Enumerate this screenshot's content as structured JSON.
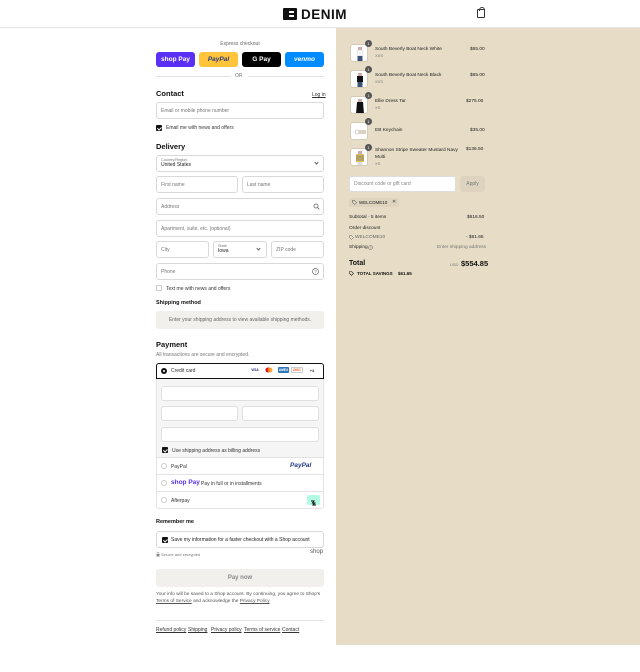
{
  "header": {
    "brand": "DENIM"
  },
  "express": {
    "label": "Express checkout",
    "shop_pay": "shop Pay",
    "paypal": "PayPal",
    "gpay": "G Pay",
    "venmo": "venmo",
    "or": "OR"
  },
  "contact": {
    "title": "Contact",
    "login": "Log in",
    "email_placeholder": "Email or mobile phone number",
    "news_label": "Email me with news and offers"
  },
  "delivery": {
    "title": "Delivery",
    "country_label": "Country/Region",
    "country_value": "United States",
    "first_name": "First name",
    "last_name": "Last name",
    "address": "Address",
    "apartment": "Apartment, suite, etc. (optional)",
    "city": "City",
    "state_label": "State",
    "state_value": "Iowa",
    "zip": "ZIP code",
    "phone": "Phone",
    "text_offers": "Text me with news and offers"
  },
  "shipping": {
    "title": "Shipping method",
    "placeholder": "Enter your shipping address to view available shipping methods."
  },
  "payment": {
    "title": "Payment",
    "subtitle": "All transactions are secure and encrypted.",
    "credit_card": "Credit card",
    "brands": [
      "VISA",
      "MC",
      "AMEX",
      "DISC",
      "+4"
    ],
    "billing_same": "Use shipping address as billing address",
    "paypal": "PayPal",
    "paypal_logo": "PayPal",
    "shop_pay_logo": "shop Pay",
    "shop_pay_text": "Pay in full or in installments",
    "afterpay": "Afterpay"
  },
  "remember": {
    "title": "Remember me",
    "save_label": "Save my information for a faster checkout with a Shop account",
    "secure": "Secure and encrypted",
    "shop": "shop"
  },
  "pay_now": "Pay now",
  "legal": {
    "line1": "Your info will be saved to a Shop account. By continuing, you agree to Shop's",
    "terms": "Terms of Service",
    "mid": "and acknowledge the",
    "privacy": "Privacy Policy"
  },
  "footer_links": [
    "Refund policy",
    "Shipping",
    "Privacy policy",
    "Terms of service",
    "Contact"
  ],
  "cart": {
    "items": [
      {
        "name": "South Beverly Boat Neck White",
        "variant": "XXS",
        "price": "$65.00",
        "qty": "1"
      },
      {
        "name": "South Beverly Boat Neck Black",
        "variant": "XXS",
        "price": "$65.00",
        "qty": "1"
      },
      {
        "name": "Ellie Dress Tar",
        "variant": "XS",
        "price": "$275.00",
        "qty": "1"
      },
      {
        "name": "EB Keychain",
        "variant": "",
        "price": "$35.00",
        "qty": "1"
      },
      {
        "name": "Shannon Stripe Sweater Mustard Navy Multi",
        "variant": "XS",
        "price": "$136.50",
        "qty": "1"
      }
    ],
    "discount_placeholder": "Discount code or gift card",
    "apply": "Apply",
    "code_chip": "WELCOME10",
    "subtotal_label": "Subtotal · 5 items",
    "subtotal": "$616.50",
    "order_discount_label": "Order discount",
    "discount_code": "WELCOME10",
    "discount_value": "- $61.65",
    "shipping_label": "Shipping",
    "shipping_value": "Enter shipping address",
    "total_label": "Total",
    "currency": "USD",
    "total": "$554.85",
    "savings_label": "TOTAL SAVINGS",
    "savings": "$61.65"
  },
  "colors": {
    "shop_pay": "#5a31f4",
    "paypal": "#ffc439",
    "venmo": "#008cff",
    "summary_bg": "#e7dcc5"
  }
}
